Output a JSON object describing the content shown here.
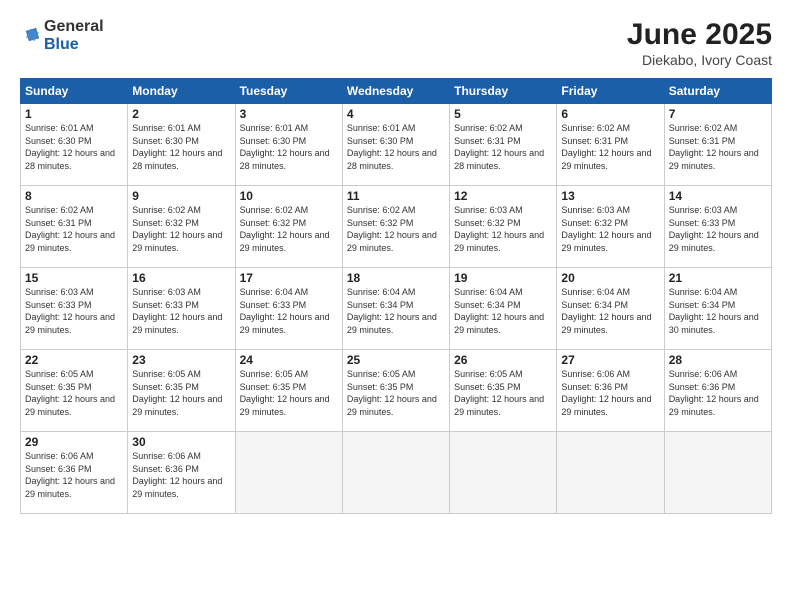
{
  "logo": {
    "general": "General",
    "blue": "Blue"
  },
  "title": "June 2025",
  "subtitle": "Diekabo, Ivory Coast",
  "days_of_week": [
    "Sunday",
    "Monday",
    "Tuesday",
    "Wednesday",
    "Thursday",
    "Friday",
    "Saturday"
  ],
  "weeks": [
    [
      {
        "day": "1",
        "sunrise": "6:01 AM",
        "sunset": "6:30 PM",
        "daylight": "12 hours and 28 minutes."
      },
      {
        "day": "2",
        "sunrise": "6:01 AM",
        "sunset": "6:30 PM",
        "daylight": "12 hours and 28 minutes."
      },
      {
        "day": "3",
        "sunrise": "6:01 AM",
        "sunset": "6:30 PM",
        "daylight": "12 hours and 28 minutes."
      },
      {
        "day": "4",
        "sunrise": "6:01 AM",
        "sunset": "6:30 PM",
        "daylight": "12 hours and 28 minutes."
      },
      {
        "day": "5",
        "sunrise": "6:02 AM",
        "sunset": "6:31 PM",
        "daylight": "12 hours and 28 minutes."
      },
      {
        "day": "6",
        "sunrise": "6:02 AM",
        "sunset": "6:31 PM",
        "daylight": "12 hours and 29 minutes."
      },
      {
        "day": "7",
        "sunrise": "6:02 AM",
        "sunset": "6:31 PM",
        "daylight": "12 hours and 29 minutes."
      }
    ],
    [
      {
        "day": "8",
        "sunrise": "6:02 AM",
        "sunset": "6:31 PM",
        "daylight": "12 hours and 29 minutes."
      },
      {
        "day": "9",
        "sunrise": "6:02 AM",
        "sunset": "6:32 PM",
        "daylight": "12 hours and 29 minutes."
      },
      {
        "day": "10",
        "sunrise": "6:02 AM",
        "sunset": "6:32 PM",
        "daylight": "12 hours and 29 minutes."
      },
      {
        "day": "11",
        "sunrise": "6:02 AM",
        "sunset": "6:32 PM",
        "daylight": "12 hours and 29 minutes."
      },
      {
        "day": "12",
        "sunrise": "6:03 AM",
        "sunset": "6:32 PM",
        "daylight": "12 hours and 29 minutes."
      },
      {
        "day": "13",
        "sunrise": "6:03 AM",
        "sunset": "6:32 PM",
        "daylight": "12 hours and 29 minutes."
      },
      {
        "day": "14",
        "sunrise": "6:03 AM",
        "sunset": "6:33 PM",
        "daylight": "12 hours and 29 minutes."
      }
    ],
    [
      {
        "day": "15",
        "sunrise": "6:03 AM",
        "sunset": "6:33 PM",
        "daylight": "12 hours and 29 minutes."
      },
      {
        "day": "16",
        "sunrise": "6:03 AM",
        "sunset": "6:33 PM",
        "daylight": "12 hours and 29 minutes."
      },
      {
        "day": "17",
        "sunrise": "6:04 AM",
        "sunset": "6:33 PM",
        "daylight": "12 hours and 29 minutes."
      },
      {
        "day": "18",
        "sunrise": "6:04 AM",
        "sunset": "6:34 PM",
        "daylight": "12 hours and 29 minutes."
      },
      {
        "day": "19",
        "sunrise": "6:04 AM",
        "sunset": "6:34 PM",
        "daylight": "12 hours and 29 minutes."
      },
      {
        "day": "20",
        "sunrise": "6:04 AM",
        "sunset": "6:34 PM",
        "daylight": "12 hours and 29 minutes."
      },
      {
        "day": "21",
        "sunrise": "6:04 AM",
        "sunset": "6:34 PM",
        "daylight": "12 hours and 30 minutes."
      }
    ],
    [
      {
        "day": "22",
        "sunrise": "6:05 AM",
        "sunset": "6:35 PM",
        "daylight": "12 hours and 29 minutes."
      },
      {
        "day": "23",
        "sunrise": "6:05 AM",
        "sunset": "6:35 PM",
        "daylight": "12 hours and 29 minutes."
      },
      {
        "day": "24",
        "sunrise": "6:05 AM",
        "sunset": "6:35 PM",
        "daylight": "12 hours and 29 minutes."
      },
      {
        "day": "25",
        "sunrise": "6:05 AM",
        "sunset": "6:35 PM",
        "daylight": "12 hours and 29 minutes."
      },
      {
        "day": "26",
        "sunrise": "6:05 AM",
        "sunset": "6:35 PM",
        "daylight": "12 hours and 29 minutes."
      },
      {
        "day": "27",
        "sunrise": "6:06 AM",
        "sunset": "6:36 PM",
        "daylight": "12 hours and 29 minutes."
      },
      {
        "day": "28",
        "sunrise": "6:06 AM",
        "sunset": "6:36 PM",
        "daylight": "12 hours and 29 minutes."
      }
    ],
    [
      {
        "day": "29",
        "sunrise": "6:06 AM",
        "sunset": "6:36 PM",
        "daylight": "12 hours and 29 minutes."
      },
      {
        "day": "30",
        "sunrise": "6:06 AM",
        "sunset": "6:36 PM",
        "daylight": "12 hours and 29 minutes."
      },
      null,
      null,
      null,
      null,
      null
    ]
  ]
}
